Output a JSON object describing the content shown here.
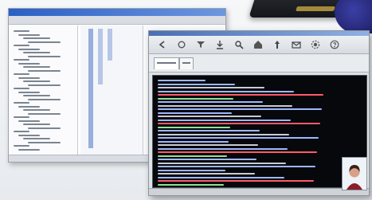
{
  "colors": {
    "background": "#eef0f3",
    "titlebar_blue": "#2a5fc4",
    "terminal_bg": "#06080b",
    "terminal_blue": "#9fb7ff",
    "terminal_red": "#ff5a6a",
    "terminal_green": "#8fe39a",
    "terminal_gray": "#c9cbd4"
  },
  "icons": {
    "front_toolbar": [
      "back-arrow-icon",
      "refresh-icon",
      "filter-icon",
      "download-icon",
      "search-icon",
      "home-icon",
      "pin-icon",
      "mail-icon",
      "settings-icon",
      "help-icon"
    ]
  },
  "photo_icon": "user-photo-icon"
}
